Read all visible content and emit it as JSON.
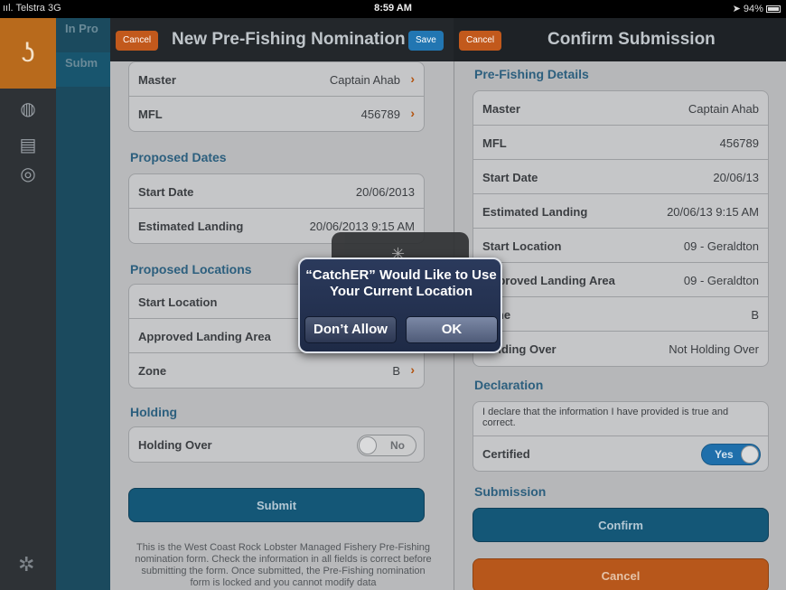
{
  "status_bar": {
    "carrier": "Telstra",
    "network": "3G",
    "time": "8:59 AM",
    "battery": "94%"
  },
  "sidebar": {
    "logo_icon": "fishhook-icon",
    "icons": [
      "globe-icon",
      "document-icon",
      "lifebuoy-icon"
    ],
    "items": [
      {
        "label": "In Pro"
      },
      {
        "label": "Subm"
      }
    ],
    "settings_icon": "gear-icon"
  },
  "nomination": {
    "cancel_label": "Cancel",
    "title": "New Pre-Fishing Nomination",
    "save_label": "Save",
    "master_label": "Master",
    "master_value": "Captain Ahab",
    "mfl_label": "MFL",
    "mfl_value": "456789",
    "dates_title": "Proposed Dates",
    "start_date_label": "Start Date",
    "start_date_value": "20/06/2013",
    "landing_label": "Estimated Landing",
    "landing_value": "20/06/2013 9:15 AM",
    "locations_title": "Proposed Locations",
    "start_location_label": "Start Location",
    "approved_landing_label": "Approved Landing Area",
    "zone_label": "Zone",
    "zone_value": "B",
    "holding_title": "Holding",
    "holding_label": "Holding Over",
    "holding_toggle": "No",
    "submit_label": "Submit",
    "footnote": "This is the West Coast Rock Lobster Managed Fishery Pre-Fishing nomination form. Check the information in all fields is correct before submitting the form. Once submitted, the Pre-Fishing nomination form is locked and you cannot modify data"
  },
  "confirm": {
    "cancel_label": "Cancel",
    "title": "Confirm Submission",
    "details_title": "Pre-Fishing Details",
    "rows": [
      {
        "label": "Master",
        "value": "Captain Ahab"
      },
      {
        "label": "MFL",
        "value": "456789"
      },
      {
        "label": "Start Date",
        "value": "20/06/13"
      },
      {
        "label": "Estimated Landing",
        "value": "20/06/13 9:15 AM"
      },
      {
        "label": "Start Location",
        "value": "09 - Geraldton"
      },
      {
        "label": "Approved Landing Area",
        "value": "09 - Geraldton"
      },
      {
        "label": "Zone",
        "value": "B"
      },
      {
        "label": "Holding Over",
        "value": "Not Holding Over"
      }
    ],
    "declaration_title": "Declaration",
    "declaration_text": "I declare that the information I have provided is true and correct.",
    "certified_label": "Certified",
    "certified_toggle": "Yes",
    "submission_title": "Submission",
    "confirm_label": "Confirm",
    "cancel_button_label": "Cancel"
  },
  "alert": {
    "title": "“CatchER” Would Like to Use Your Current Location",
    "deny_label": "Don’t Allow",
    "ok_label": "OK"
  }
}
